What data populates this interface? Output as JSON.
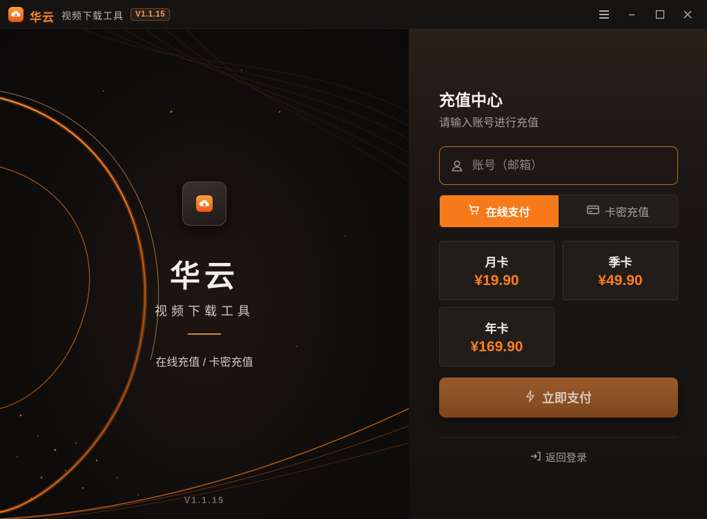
{
  "titlebar": {
    "app_name": "华云",
    "app_subtitle": "视频下载工具",
    "version": "V1.1.15",
    "icons": [
      "menu-icon",
      "minimize-icon",
      "maximize-icon",
      "close-icon"
    ]
  },
  "hero": {
    "brand": "华云",
    "tagline": "视频下载工具",
    "modes": "在线充值 / 卡密充值",
    "version": "V1.1.15"
  },
  "recharge": {
    "title": "充值中心",
    "subtitle": "请输入账号进行充值",
    "account_placeholder": "账号（邮箱）",
    "account_value": "",
    "tabs": [
      {
        "label": "在线支付",
        "icon": "cart-icon",
        "active": true
      },
      {
        "label": "卡密充值",
        "icon": "card-icon",
        "active": false
      }
    ],
    "plans": [
      {
        "name": "月卡",
        "price": "¥19.90"
      },
      {
        "name": "季卡",
        "price": "¥49.90"
      },
      {
        "name": "年卡",
        "price": "¥169.90"
      }
    ],
    "pay_button": "立即支付",
    "back_link": "返回登录"
  },
  "colors": {
    "accent": "#f77a1a",
    "price": "#ff7d1e",
    "background": "#0e0c0b"
  }
}
